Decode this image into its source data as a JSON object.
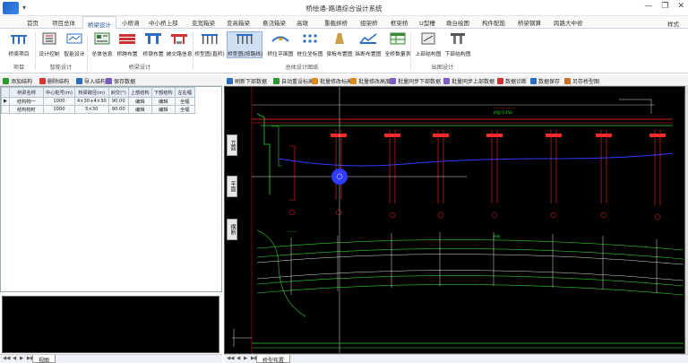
{
  "window": {
    "title": "桥绘通-路通综合设计系统",
    "quick_access": "▾",
    "controls": [
      "—",
      "❐",
      "✕"
    ]
  },
  "tabs": [
    "首页",
    "项目总体",
    "桥梁设计",
    "小桥涵",
    "中小桥上部",
    "变宽箱梁",
    "变高箱梁",
    "悬浇箱梁",
    "高墩",
    "重载拼桥",
    "组架桥",
    "框架桥",
    "U型槽",
    "墩台绘图",
    "构件配筋",
    "桥梁钢算",
    "跨路大中修"
  ],
  "active_tab": "桥梁设计",
  "style_label": "样式",
  "ribbon": {
    "buttons": [
      {
        "label": "桥梁项目",
        "icon": "bridge-project-icon"
      },
      {
        "label": "设计控制",
        "icon": "design-control-icon"
      },
      {
        "label": "智能设计",
        "icon": "smart-design-icon"
      },
      {
        "label": "总体信息",
        "icon": "overall-info-icon"
      },
      {
        "label": "桥跨布置",
        "icon": "span-layout-icon"
      },
      {
        "label": "桥墩布置",
        "icon": "pier-layout-icon"
      },
      {
        "label": "被交路信息",
        "icon": "crossing-road-icon"
      },
      {
        "label": "桥型图(直桥)",
        "icon": "bridge-type-straight-icon"
      },
      {
        "label": "桥型图(按路线)",
        "icon": "bridge-type-route-icon"
      },
      {
        "label": "桥位平面图",
        "icon": "bridge-plan-icon"
      },
      {
        "label": "桩位坐标图",
        "icon": "pile-coord-icon"
      },
      {
        "label": "梁板布置图",
        "icon": "girder-layout-icon"
      },
      {
        "label": "纵断布置图",
        "icon": "profile-layout-icon"
      },
      {
        "label": "全桥数量表",
        "icon": "quantity-table-icon"
      },
      {
        "label": "上部结构图",
        "icon": "superstructure-icon"
      },
      {
        "label": "下部结构图",
        "icon": "substructure-icon"
      }
    ],
    "groups": [
      "项目",
      "智能设计",
      "桥梁设计",
      "总体设计图纸",
      "出图设计"
    ]
  },
  "left_toolbar": [
    "添加结构",
    "删除结构",
    "导入结构",
    "保存数据"
  ],
  "table": {
    "headers": [
      "桥梁名称",
      "中心桩号(m)",
      "桥梁跨径(m)",
      "斜交(°)",
      "上部结构",
      "下部结构",
      "左右幅"
    ],
    "rows": [
      [
        "结构物一",
        "1000",
        "4×30+4×30",
        "90.00",
        "编辑",
        "编辑",
        "全幅"
      ],
      [
        "结构物时",
        "1000",
        "5×30",
        "90.00",
        "编辑",
        "编辑",
        "全幅"
      ]
    ]
  },
  "left_sheet_tab": "视图",
  "right_toolbar": [
    "刷新下部数据",
    "自动重设标高",
    "批量修改标高",
    "批量修改高度",
    "批量同步下部数据",
    "批量同步上部数据",
    "数据诊断",
    "数据保存",
    "另存桥型图"
  ],
  "cad_side_tabs": [
    "立面",
    "平面",
    "横断"
  ],
  "right_sheet_tab": "桥型布置",
  "sheet_nav": [
    "◀◀",
    "◀",
    "▶",
    "▶▶"
  ],
  "colors": {
    "accent": "#1a4f9c",
    "cad_bg": "#000000",
    "cad_red": "#ff2a2a",
    "cad_green": "#2ed12e",
    "cad_blue": "#2f3cff",
    "cad_white": "#dddddd"
  }
}
